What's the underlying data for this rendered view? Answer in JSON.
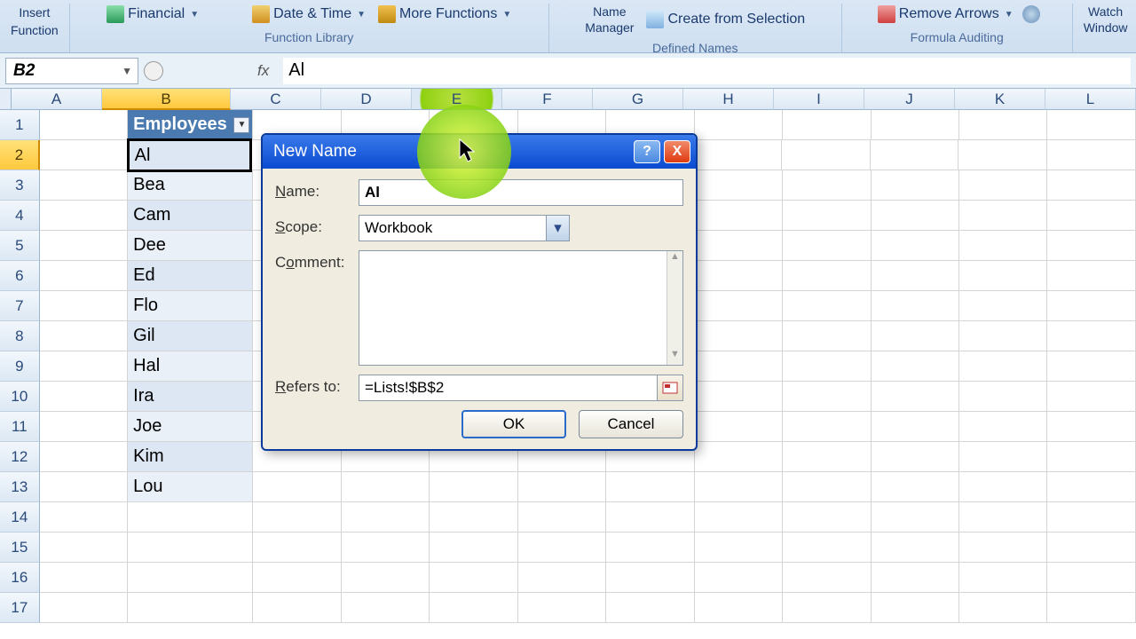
{
  "ribbon": {
    "insert_function_top": "Insert",
    "insert_function_bottom": "Function",
    "financial": "Financial",
    "date_time": "Date & Time",
    "more_functions": "More Functions",
    "function_library": "Function Library",
    "name_manager_top": "Name",
    "name_manager_bottom": "Manager",
    "create_from_selection": "Create from Selection",
    "defined_names": "Defined Names",
    "remove_arrows": "Remove Arrows",
    "formula_auditing": "Formula Auditing",
    "watch_top": "Watch",
    "watch_bottom": "Window"
  },
  "formula_bar": {
    "name_box": "B2",
    "fx": "fx",
    "formula": "Al"
  },
  "columns": [
    "A",
    "B",
    "C",
    "D",
    "E",
    "F",
    "G",
    "H",
    "I",
    "J",
    "K",
    "L"
  ],
  "rows": [
    1,
    2,
    3,
    4,
    5,
    6,
    7,
    8,
    9,
    10,
    11,
    12,
    13,
    14,
    15,
    16,
    17
  ],
  "table": {
    "header": "Employees",
    "data": [
      "Al",
      "Bea",
      "Cam",
      "Dee",
      "Ed",
      "Flo",
      "Gil",
      "Hal",
      "Ira",
      "Joe",
      "Kim",
      "Lou"
    ]
  },
  "dialog": {
    "title": "New Name",
    "name_label": "Name:",
    "name_value": "Al",
    "scope_label": "Scope:",
    "scope_value": "Workbook",
    "comment_label": "Comment:",
    "comment_value": "",
    "refers_label": "Refers to:",
    "refers_value": "=Lists!$B$2",
    "ok": "OK",
    "cancel": "Cancel",
    "help": "?",
    "close": "X"
  }
}
